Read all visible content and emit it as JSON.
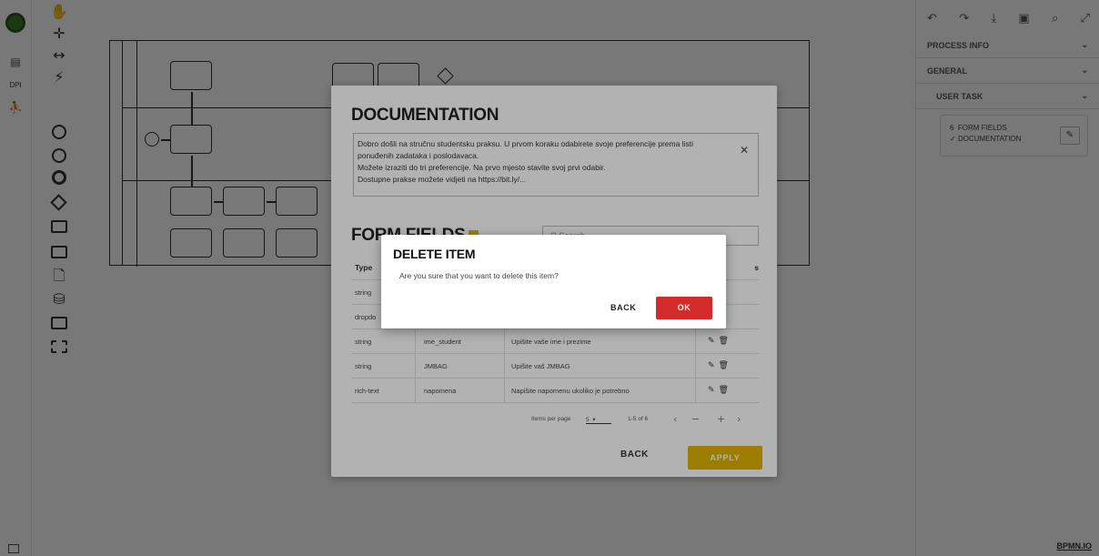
{
  "app": {
    "rail_text": "DPI",
    "watermark": "BPMN.IO"
  },
  "right_panel": {
    "sections": [
      "PROCESS INFO",
      "GENERAL",
      "USER TASK"
    ],
    "card_count": "6",
    "card_line1": "FORM FIELDS",
    "card_line2": "DOCUMENTATION"
  },
  "doc_modal": {
    "title": "DOCUMENTATION",
    "doc_lines": [
      "Dobro došli na stručnu studentsku praksu. U prvom koraku odabirete svoje preferencije prema listi",
      "ponuđenih zadataka i poslodavaca.",
      "Možete izraziti do tri preferencije. Na prvo mjesto stavite svoj prvi odabir.",
      "Dostupne prakse možete vidjeti na https://bit.ly/..."
    ],
    "form_fields_title": "FORM FIELDS",
    "search_placeholder": "Q  Search",
    "columns": [
      "Type",
      "",
      "",
      "s"
    ],
    "rows": [
      {
        "type": "string",
        "name": "",
        "label": ""
      },
      {
        "type": "dropdo",
        "name": "",
        "label": ""
      },
      {
        "type": "string",
        "name": "ime_student",
        "label": "Upišite vaše ime i prezime"
      },
      {
        "type": "string",
        "name": "JMBAG",
        "label": "Upišite vaš JMBAG"
      },
      {
        "type": "rich-text",
        "name": "napomena",
        "label": "Napišite napomenu ukoliko je potrebno"
      }
    ],
    "pager": {
      "items_per_page_label": "Items per page",
      "items_per_page_value": "5",
      "range": "1-5 of 6"
    },
    "back_label": "BACK",
    "apply_label": "APPLY"
  },
  "delete_dialog": {
    "title": "DELETE ITEM",
    "message": "Are you sure that you want to delete this item?",
    "back_label": "BACK",
    "ok_label": "OK"
  },
  "colors": {
    "danger": "#d32a2a",
    "apply": "#e0b400",
    "badge": "#e0c200"
  }
}
